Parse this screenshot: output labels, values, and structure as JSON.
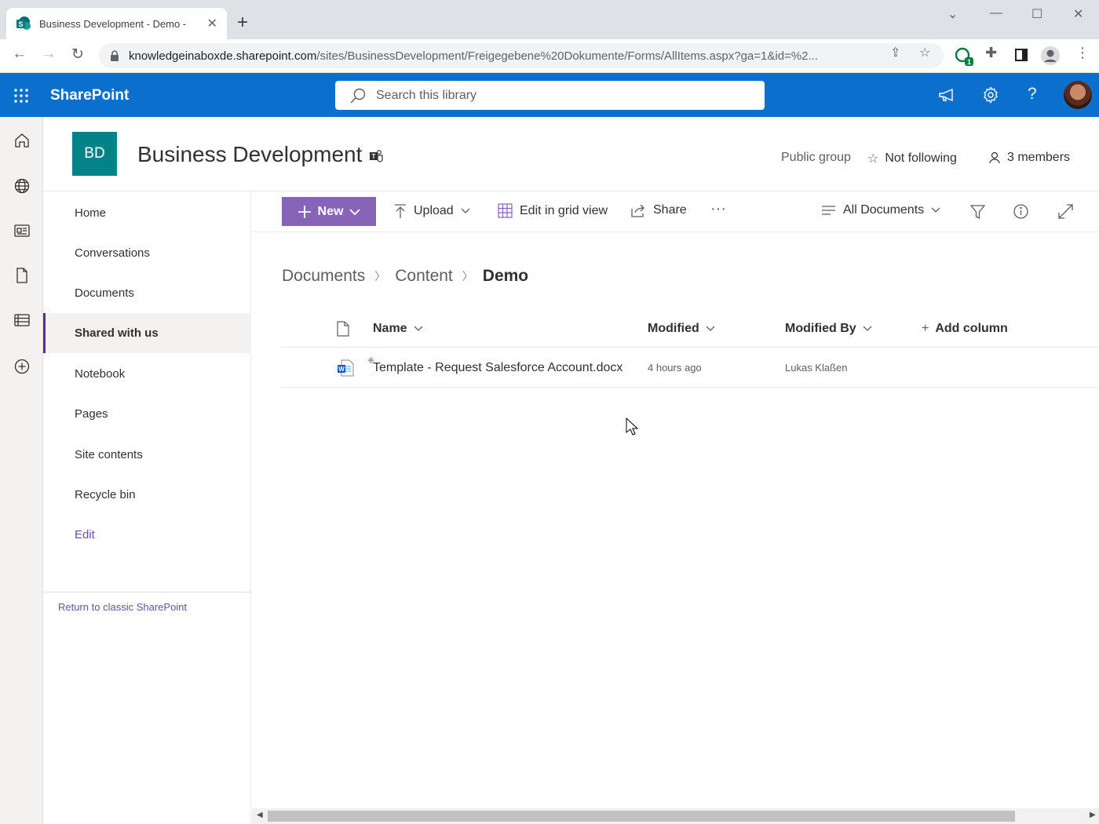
{
  "browser": {
    "tab_title": "Business Development - Demo - ",
    "url_host": "knowledgeinaboxde.sharepoint.com",
    "url_path": "/sites/BusinessDevelopment/Freigegebene%20Dokumente/Forms/AllItems.aspx?ga=1&id=%2...",
    "extension_badge": "1"
  },
  "header": {
    "brand": "SharePoint",
    "search_placeholder": "Search this library"
  },
  "site": {
    "logo_initials": "BD",
    "title": "Business Development",
    "visibility": "Public group",
    "follow": "Not following",
    "members": "3 members"
  },
  "quicknav": {
    "items": [
      {
        "label": "Home"
      },
      {
        "label": "Conversations"
      },
      {
        "label": "Documents"
      },
      {
        "label": "Shared with us",
        "active": true
      },
      {
        "label": "Notebook"
      },
      {
        "label": "Pages"
      },
      {
        "label": "Site contents"
      },
      {
        "label": "Recycle bin"
      }
    ],
    "edit": "Edit",
    "classic_link": "Return to classic SharePoint"
  },
  "commandbar": {
    "new": "New",
    "upload": "Upload",
    "grid": "Edit in grid view",
    "share": "Share",
    "more": "···",
    "view": "All Documents"
  },
  "breadcrumb": [
    "Documents",
    "Content",
    "Demo"
  ],
  "list": {
    "columns": {
      "name": "Name",
      "modified": "Modified",
      "modified_by": "Modified By",
      "add_column": "Add column"
    },
    "rows": [
      {
        "name": "Template -  Request Salesforce Account.docx",
        "modified": "4 hours ago",
        "modified_by": "Lukas Klaßen"
      }
    ]
  },
  "colors": {
    "suite_bar": "#0b6fce",
    "accent": "#8764b8",
    "site_logo": "#038387"
  }
}
